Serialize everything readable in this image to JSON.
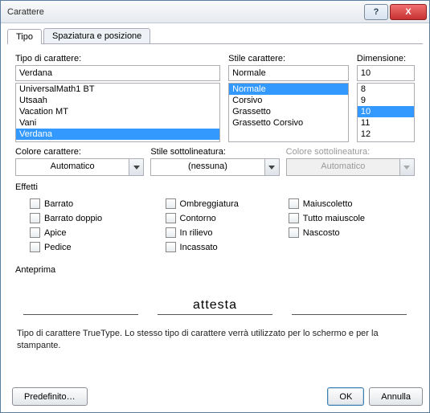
{
  "window": {
    "title": "Carattere",
    "help": "?",
    "close": "X"
  },
  "tabs": {
    "type_tab": "Tipo",
    "spacing_tab": "Spaziatura e posizione"
  },
  "font": {
    "label": "Tipo di carattere:",
    "value": "Verdana",
    "options": [
      "UniversalMath1 BT",
      "Utsaah",
      "Vacation MT",
      "Vani",
      "Verdana"
    ],
    "selected": "Verdana"
  },
  "style": {
    "label": "Stile carattere:",
    "value": "Normale",
    "options": [
      "Normale",
      "Corsivo",
      "Grassetto",
      "Grassetto Corsivo"
    ],
    "selected": "Normale"
  },
  "size": {
    "label": "Dimensione:",
    "value": "10",
    "options": [
      "8",
      "9",
      "10",
      "11",
      "12"
    ],
    "selected": "10"
  },
  "color": {
    "label": "Colore carattere:",
    "value": "Automatico"
  },
  "under_st": {
    "label": "Stile sottolineatura:",
    "value": "(nessuna)"
  },
  "under_cl": {
    "label": "Colore sottolineatura:",
    "value": "Automatico"
  },
  "effects": {
    "label": "Effetti",
    "items": {
      "strike": "Barrato",
      "shadow": "Ombreggiatura",
      "smallcaps": "Maiuscoletto",
      "dstrike": "Barrato doppio",
      "outline": "Contorno",
      "allcaps": "Tutto maiuscole",
      "super": "Apice",
      "emboss": "In rilievo",
      "hidden": "Nascosto",
      "sub": "Pedice",
      "engrave": "Incassato"
    }
  },
  "preview": {
    "label": "Anteprima",
    "sample": "attesta"
  },
  "footnote": "Tipo di carattere TrueType. Lo stesso tipo di carattere verrà utilizzato per lo schermo e per la stampante.",
  "buttons": {
    "default": "Predefinito…",
    "ok": "OK",
    "cancel": "Annulla"
  }
}
